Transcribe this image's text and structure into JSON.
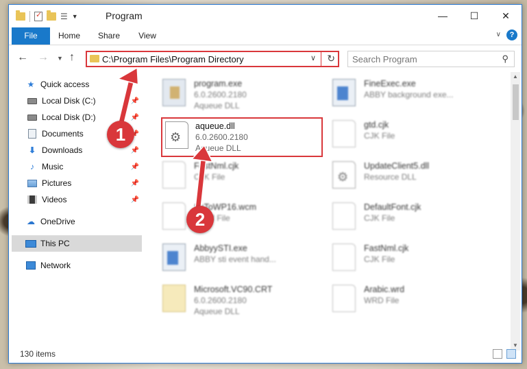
{
  "window": {
    "title": "Program"
  },
  "ribbon": {
    "file": "File",
    "home": "Home",
    "share": "Share",
    "view": "View"
  },
  "address": {
    "path": "C:\\Program Files\\Program Directory"
  },
  "search": {
    "placeholder": "Search Program"
  },
  "nav": {
    "quick_access": "Quick access",
    "items": [
      {
        "label": "Local Disk (C:)"
      },
      {
        "label": "Local Disk (D:)"
      },
      {
        "label": "Documents"
      },
      {
        "label": "Downloads"
      },
      {
        "label": "Music"
      },
      {
        "label": "Pictures"
      },
      {
        "label": "Videos"
      }
    ],
    "onedrive": "OneDrive",
    "this_pc": "This PC",
    "network": "Network"
  },
  "files": [
    {
      "name": "program.exe",
      "version": "6.0.2600.2180",
      "type": "Aqueue DLL"
    },
    {
      "name": "FineExec.exe",
      "version": "ABBY background exe...",
      "type": ""
    },
    {
      "name": "aqueue.dll",
      "version": "6.0.2600.2180",
      "type": "Aqueue DLL"
    },
    {
      "name": "gtd.cjk",
      "version": "CJK File",
      "type": ""
    },
    {
      "name": "FastNml.cjk",
      "version": "CJK File",
      "type": ""
    },
    {
      "name": "UpdateClient5.dll",
      "version": "Resource DLL",
      "type": ""
    },
    {
      "name": "SkToWP16.wcm",
      "version": "WCM File",
      "type": ""
    },
    {
      "name": "DefaultFont.cjk",
      "version": "CJK File",
      "type": ""
    },
    {
      "name": "AbbyySTI.exe",
      "version": "ABBY sti event hand...",
      "type": ""
    },
    {
      "name": "FastNml.cjk",
      "version": "CJK File",
      "type": ""
    },
    {
      "name": "Microsoft.VC90.CRT",
      "version": "6.0.2600.2180",
      "type": "Aqueue DLL"
    },
    {
      "name": "Arabic.wrd",
      "version": "WRD File",
      "type": ""
    }
  ],
  "status": {
    "count": "130 items"
  },
  "callouts": {
    "one": "1",
    "two": "2",
    "color": "#d9373b"
  }
}
